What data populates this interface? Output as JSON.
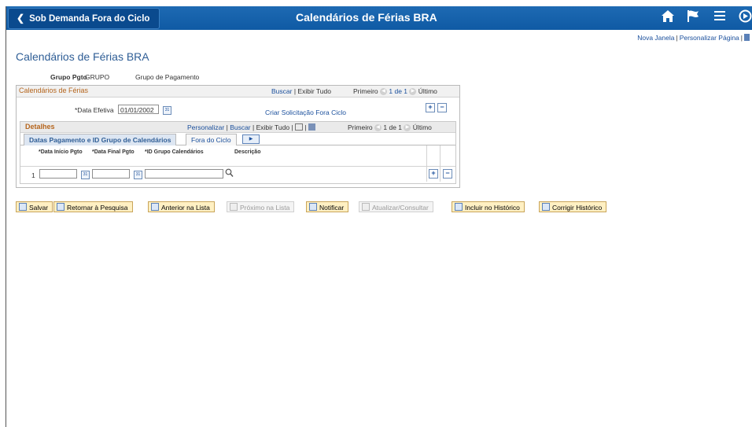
{
  "header": {
    "back_label": "Sob Demanda Fora do Ciclo",
    "title": "Calendários de Férias BRA",
    "icons": [
      "home-icon",
      "flag-icon",
      "hamburger-menu-icon",
      "navbar-icon"
    ]
  },
  "top_links": {
    "new_window": "Nova Janela",
    "personalize": "Personalizar Página"
  },
  "page_title": "Calendários de Férias BRA",
  "group": {
    "label": "Grupo Pgto",
    "value": "GRUPO",
    "description": "Grupo de Pagamento"
  },
  "calendars_grid": {
    "title": "Calendários de Férias",
    "find": "Buscar",
    "view_all": "Exibir Tudo",
    "first": "Primeiro",
    "range": "1 de 1",
    "last": "Último",
    "effective_date_label": "*Data Efetiva",
    "effective_date_value": "01/01/2002",
    "create_request_link": "Criar Solicitação Fora Ciclo"
  },
  "details_grid": {
    "title": "Detalhes",
    "personalize": "Personalizar",
    "find": "Buscar",
    "view_all": "Exibir Tudo",
    "first": "Primeiro",
    "range": "1 de 1",
    "last": "Último",
    "tabs": [
      {
        "label": "Datas Pagamento e ID Grupo de Calendários",
        "active": true
      },
      {
        "label": "Fora do Ciclo",
        "active": false
      }
    ],
    "columns": [
      "*Data Início Pgto",
      "*Data Final Pgto",
      "*ID Grupo Calendários",
      "Descrição"
    ],
    "rows": [
      {
        "num": "1",
        "start": "",
        "end": "",
        "group_id": "",
        "description": ""
      }
    ]
  },
  "toolbar": {
    "buttons": [
      {
        "label": "Salvar",
        "enabled": true
      },
      {
        "label": "Retornar à Pesquisa",
        "enabled": true
      },
      {
        "label": "Anterior na Lista",
        "enabled": true
      },
      {
        "label": "Próximo na Lista",
        "enabled": false
      },
      {
        "label": "Notificar",
        "enabled": true
      },
      {
        "label": "Atualizar/Consultar",
        "enabled": false
      },
      {
        "label": "Incluir no Histórico",
        "enabled": true
      },
      {
        "label": "Corrigir Histórico",
        "enabled": true
      }
    ]
  },
  "colors": {
    "header_bg": "#1162ad",
    "link": "#1a4f9c",
    "title": "#2f5e96",
    "button_bg": "#fff0c3"
  }
}
